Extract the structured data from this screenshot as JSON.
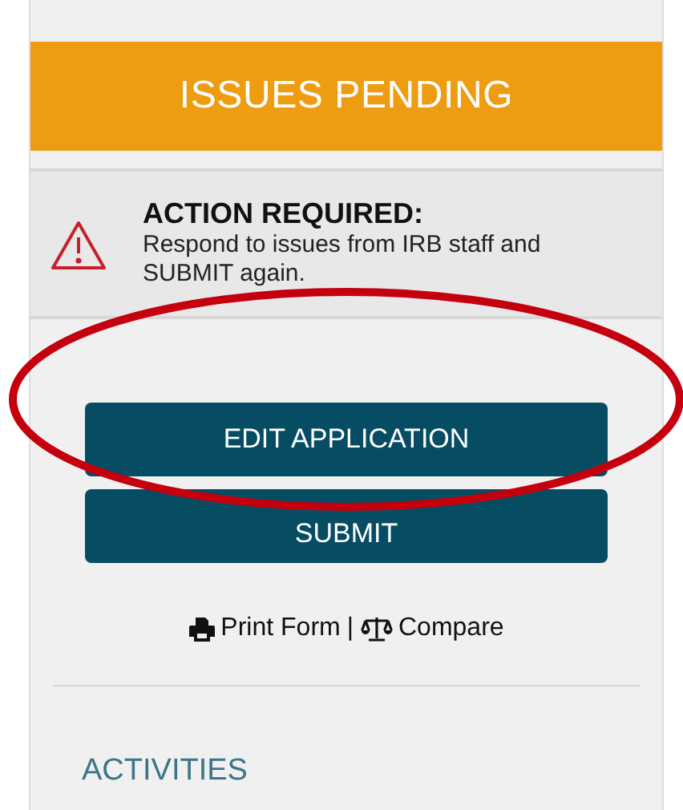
{
  "status_banner": {
    "text": "ISSUES PENDING"
  },
  "alert": {
    "title": "ACTION REQUIRED:",
    "message": "Respond to issues from IRB staff and SUBMIT again."
  },
  "buttons": [
    {
      "label": "EDIT APPLICATION"
    },
    {
      "label": "SUBMIT"
    }
  ],
  "links": [
    {
      "label": "Print Form"
    },
    {
      "label": "Compare"
    }
  ],
  "link_separator": "|",
  "section_heading": "ACTIVITIES",
  "annotations": [
    {
      "kind": "ellipse"
    }
  ]
}
